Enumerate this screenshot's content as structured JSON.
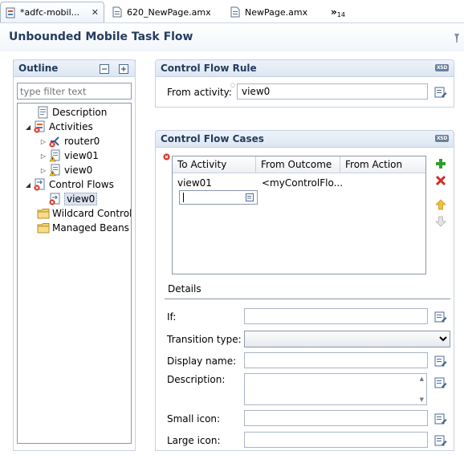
{
  "tabs": [
    {
      "label": "*adfc-mobil...",
      "close": "✕",
      "active": true
    },
    {
      "label": "620_NewPage.amx",
      "active": false
    },
    {
      "label": "NewPage.amx",
      "active": false
    }
  ],
  "tab_overflow": {
    "symbol": "»",
    "count": "14"
  },
  "header": {
    "title": "Unbounded Mobile Task Flow"
  },
  "outline": {
    "title": "Outline",
    "filter_placeholder": "type filter text",
    "nodes": [
      {
        "label": "Description",
        "icon": "description-icon"
      },
      {
        "label": "Activities",
        "icon": "activities-icon",
        "expanded": true
      },
      {
        "label": "router0",
        "icon": "router-icon"
      },
      {
        "label": "view01",
        "icon": "view-icon"
      },
      {
        "label": "view0",
        "icon": "view-icon"
      },
      {
        "label": "Control Flows",
        "icon": "control-flows-icon",
        "expanded": true
      },
      {
        "label": "view0",
        "icon": "control-flow-case-icon",
        "selected": true
      },
      {
        "label": "Wildcard Control F",
        "icon": "folder-icon"
      },
      {
        "label": "Managed Beans",
        "icon": "folder-icon"
      }
    ]
  },
  "rule": {
    "title": "Control Flow Rule",
    "from_activity_label": "From activity:",
    "from_activity_value": "view0"
  },
  "cases": {
    "title": "Control Flow Cases",
    "columns": [
      "To Activity",
      "From Outcome",
      "From Action"
    ],
    "rows": [
      {
        "to_activity": "view01",
        "from_outcome": "<myControlFlo...",
        "from_action": ""
      }
    ]
  },
  "details": {
    "title": "Details",
    "if_label": "If:",
    "transition_label": "Transition type:",
    "display_name_label": "Display name:",
    "description_label": "Description:",
    "small_icon_label": "Small icon:",
    "large_icon_label": "Large icon:"
  },
  "colors": {
    "accent": "#243c5e",
    "border": "#c5d2e3",
    "error": "#d52b1e",
    "add": "#2e9e2e"
  }
}
